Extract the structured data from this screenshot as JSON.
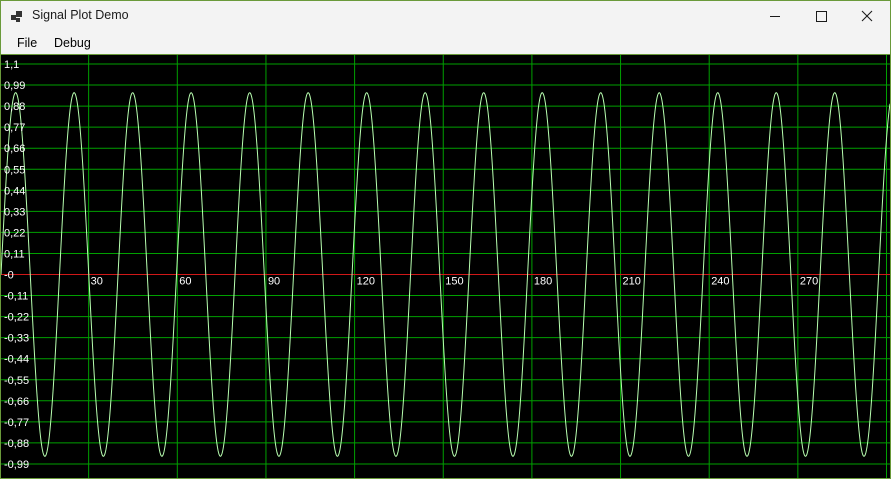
{
  "window": {
    "title": "Signal Plot Demo",
    "icons": {
      "app": "app-icon",
      "minimize": "minimize-icon",
      "maximize": "maximize-icon",
      "close": "close-icon"
    }
  },
  "menu": {
    "items": [
      {
        "label": "File"
      },
      {
        "label": "Debug"
      }
    ]
  },
  "colors": {
    "background": "#000000",
    "grid": "#00a000",
    "zero_axis": "#d01818",
    "signal": "#b8ffb0",
    "label": "#ffffff"
  },
  "chart_data": {
    "type": "line",
    "x_ticks": [
      "30",
      "60",
      "90",
      "120",
      "150",
      "180",
      "210",
      "240",
      "270"
    ],
    "y_ticks": [
      "1,1",
      "0,99",
      "0,88",
      "0,77",
      "0,66",
      "0,55",
      "0,44",
      "0,33",
      "0,22",
      "0,11",
      "-0",
      "-0,11",
      "-0,22",
      "-0,33",
      "-0,44",
      "-0,55",
      "-0,66",
      "-0,77",
      "-0,88",
      "-0,99"
    ],
    "xlim": [
      0,
      301
    ],
    "ylim": [
      -1.0,
      1.1
    ],
    "series": [
      {
        "function": "sin",
        "amplitude": 0.95,
        "period": 19.8,
        "phase": 0,
        "x_range": [
          0,
          301
        ]
      }
    ],
    "grid": true
  }
}
